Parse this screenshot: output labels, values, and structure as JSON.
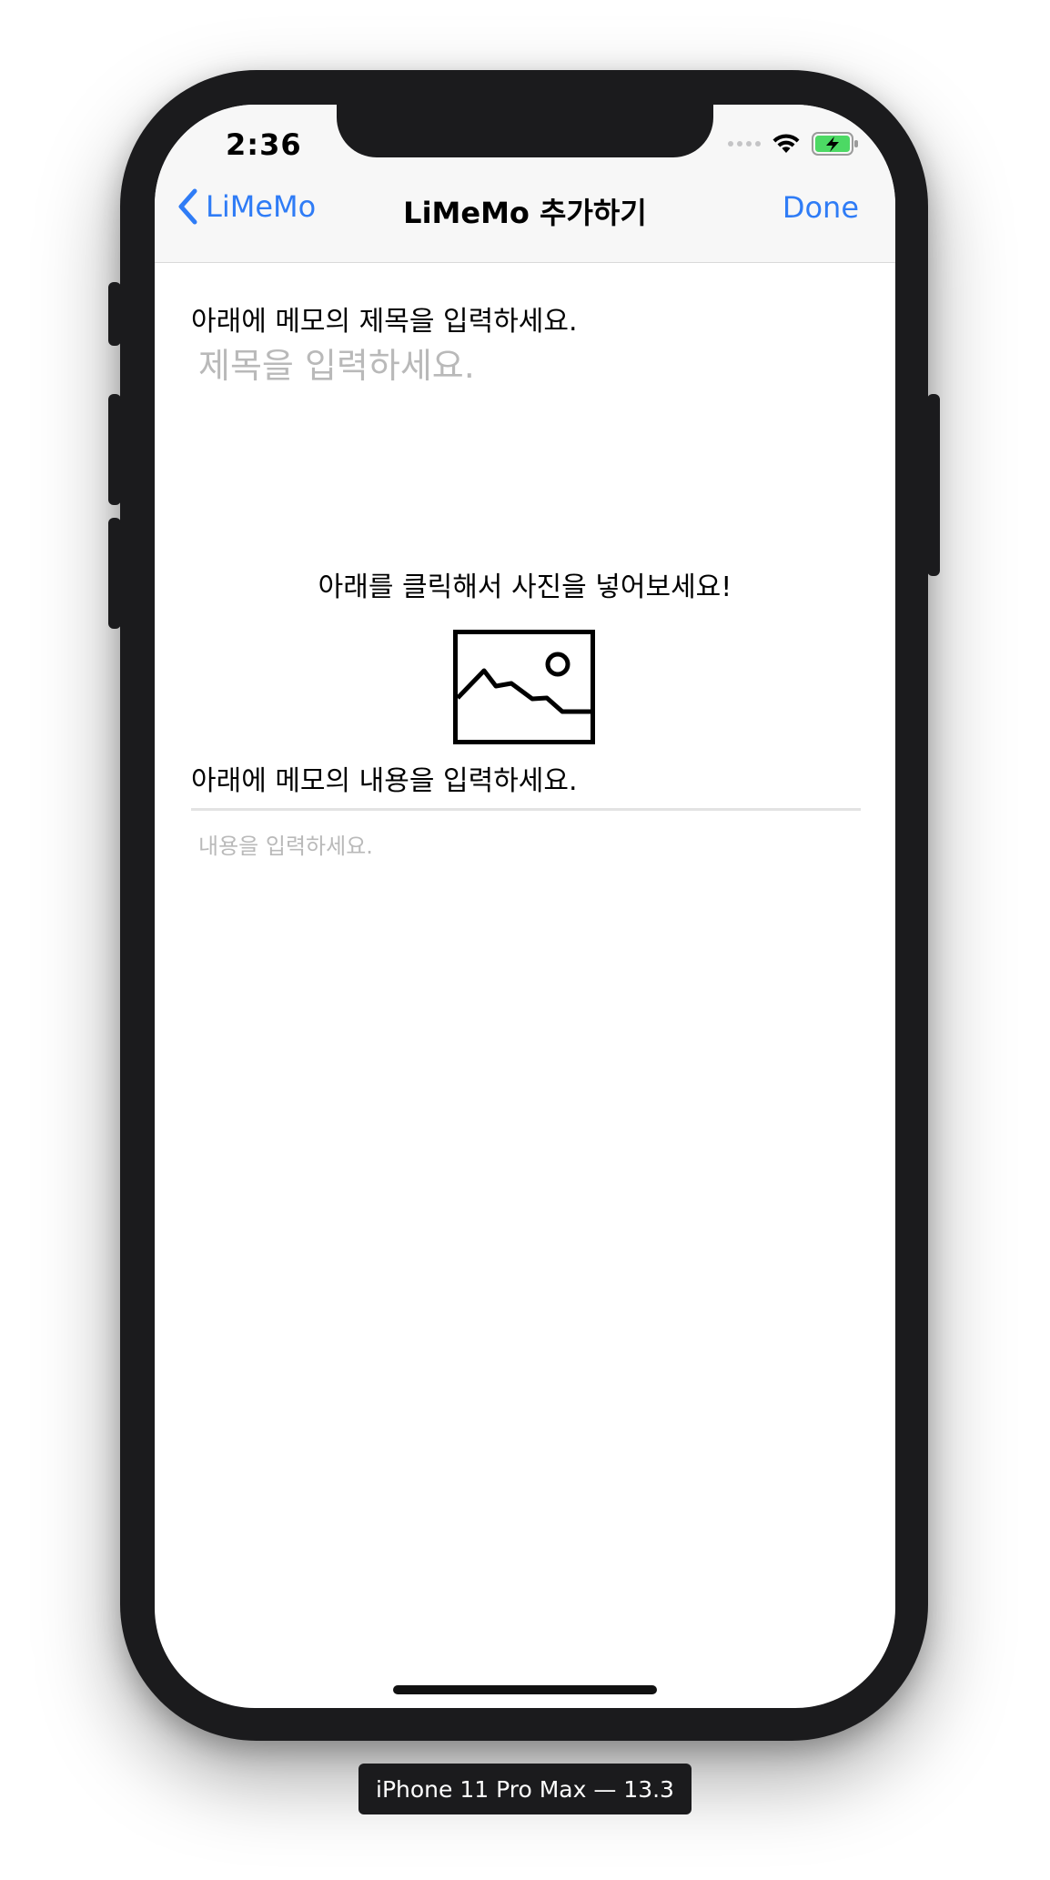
{
  "status_bar": {
    "time": "2:36",
    "icons": [
      "cellular-signal-icon",
      "wifi-icon",
      "battery-charging-icon"
    ],
    "battery_color": "#4cd964"
  },
  "nav_bar": {
    "back_label": "LiMeMo",
    "title": "LiMeMo 추가하기",
    "done_label": "Done",
    "accent_color": "#2f7cf6"
  },
  "form": {
    "title_label": "아래에 메모의 제목을 입력하세요.",
    "title_placeholder": "제목을 입력하세요.",
    "photo_hint": "아래를 클릭해서 사진을 넣어보세요!",
    "image_icon": "image-placeholder-icon",
    "content_label": "아래에 메모의 내용을 입력하세요.",
    "content_placeholder": "내용을 입력하세요."
  },
  "device_label": "iPhone 11 Pro Max — 13.3"
}
